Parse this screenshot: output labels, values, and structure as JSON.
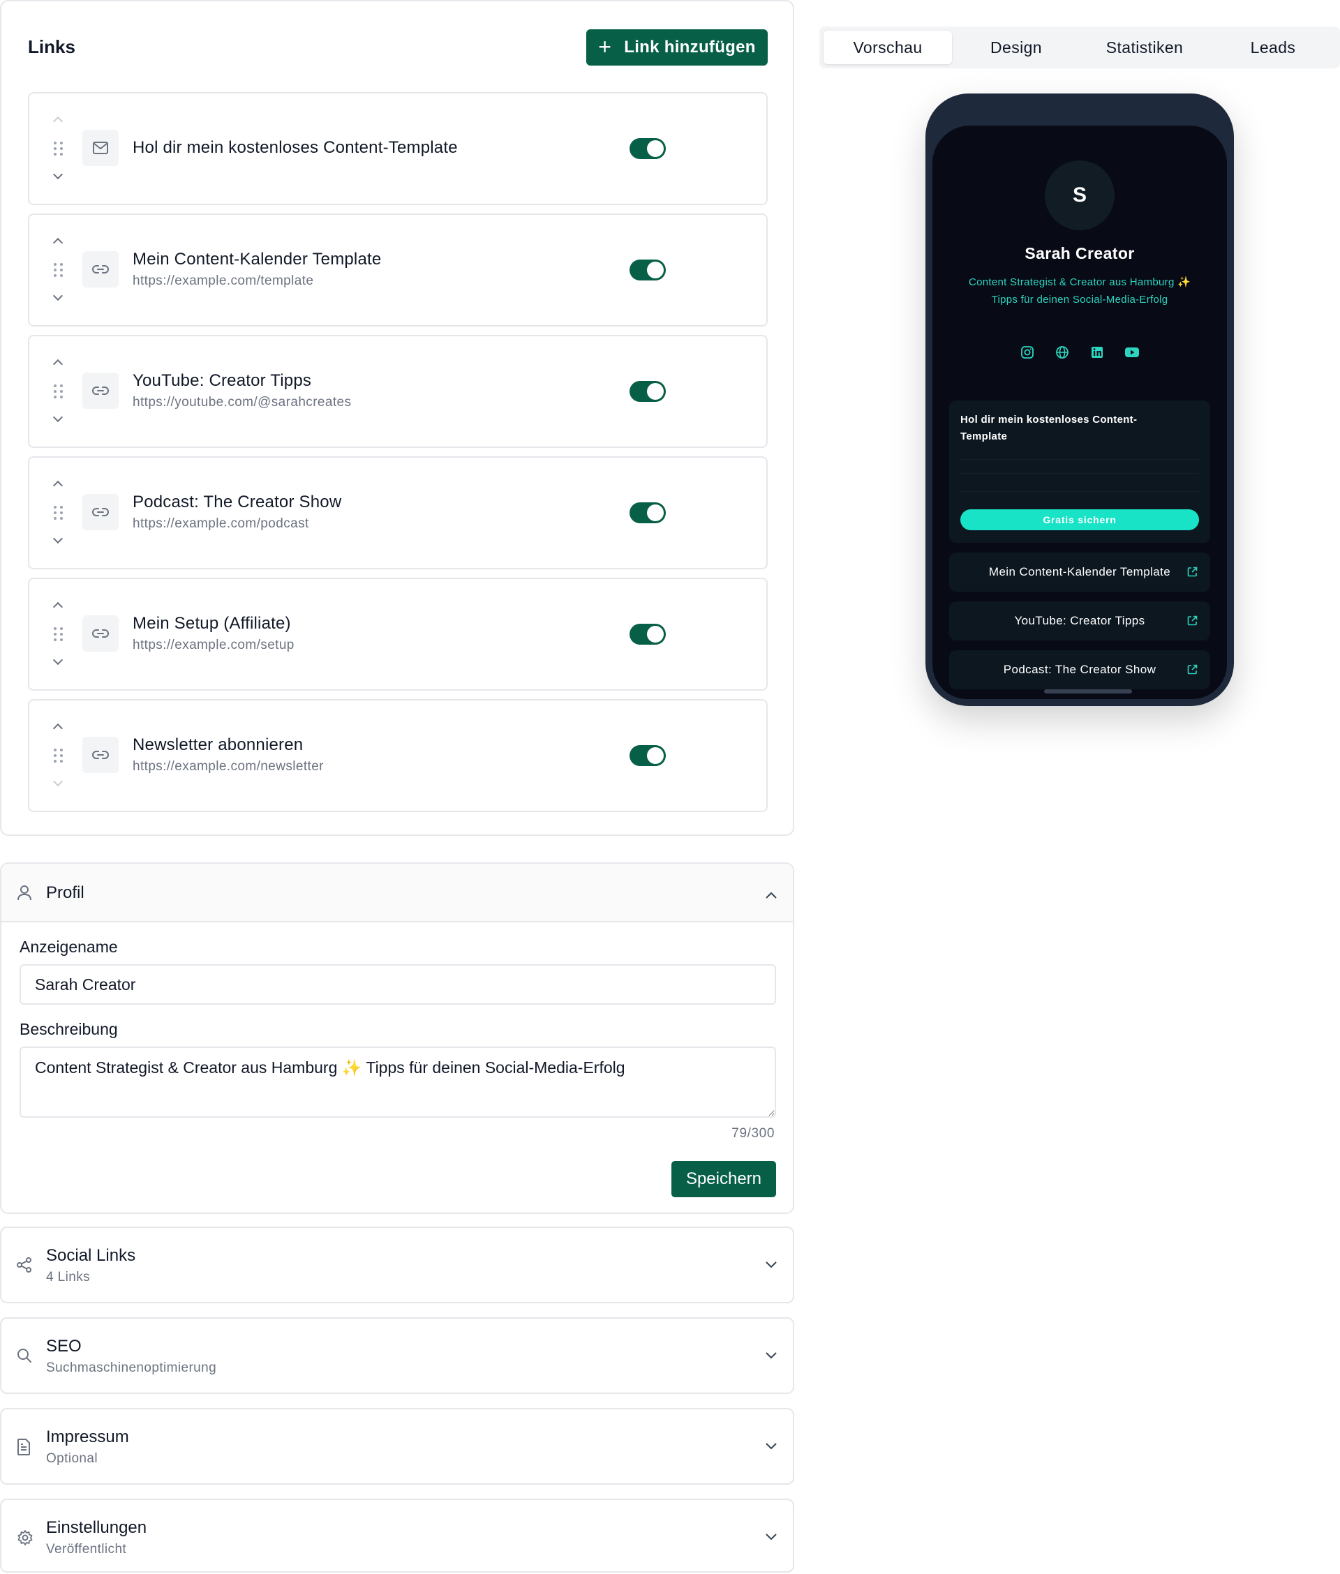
{
  "links_section": {
    "title": "Links",
    "add_button_label": "Link hinzufügen",
    "items": [
      {
        "title": "Hol dir mein kostenloses Content-Template",
        "url": "",
        "icon": "mail-icon",
        "enabled": true
      },
      {
        "title": "Mein Content-Kalender Template",
        "url": "https://example.com/template",
        "icon": "link-icon",
        "enabled": true
      },
      {
        "title": "YouTube: Creator Tipps",
        "url": "https://youtube.com/@sarahcreates",
        "icon": "link-icon",
        "enabled": true
      },
      {
        "title": "Podcast: The Creator Show",
        "url": "https://example.com/podcast",
        "icon": "link-icon",
        "enabled": true
      },
      {
        "title": "Mein Setup (Affiliate)",
        "url": "https://example.com/setup",
        "icon": "link-icon",
        "enabled": true
      },
      {
        "title": "Newsletter abonnieren",
        "url": "https://example.com/newsletter",
        "icon": "link-icon",
        "enabled": true
      }
    ]
  },
  "profil": {
    "title": "Profil",
    "display_name_label": "Anzeigename",
    "display_name_value": "Sarah Creator",
    "description_label": "Beschreibung",
    "description_value": "Content Strategist & Creator aus Hamburg ✨ Tipps für deinen Social-Media-Erfolg",
    "char_count": "79/300",
    "save_label": "Speichern"
  },
  "sections": [
    {
      "title": "Social Links",
      "subtitle": "4 Links",
      "icon": "share-icon"
    },
    {
      "title": "SEO",
      "subtitle": "Suchmaschinenoptimierung",
      "icon": "search-icon"
    },
    {
      "title": "Impressum",
      "subtitle": "Optional",
      "icon": "document-icon"
    },
    {
      "title": "Einstellungen",
      "subtitle": "Veröffentlicht",
      "icon": "gear-icon"
    }
  ],
  "tabs": [
    {
      "label": "Vorschau",
      "active": true
    },
    {
      "label": "Design",
      "active": false
    },
    {
      "label": "Statistiken",
      "active": false
    },
    {
      "label": "Leads",
      "active": false
    }
  ],
  "preview": {
    "avatar_initial": "S",
    "name": "Sarah Creator",
    "bio_line1": "Content Strategist & Creator aus Hamburg ✨",
    "bio_line2": "Tipps für deinen Social-Media-Erfolg",
    "socials": [
      "instagram-icon",
      "globe-icon",
      "linkedin-icon",
      "youtube-icon"
    ],
    "lead_title": "Hol dir mein kostenloses Content-Template",
    "lead_button": "Gratis sichern",
    "links": [
      "Mein Content-Kalender Template",
      "YouTube: Creator Tipps",
      "Podcast: The Creator Show"
    ]
  },
  "colors": {
    "primary": "#065f46",
    "accent": "#2dd4bf",
    "button_accent": "#19e3c6",
    "phone_frame": "#1e293b",
    "phone_screen": "#080b16",
    "border": "#e5e7eb"
  }
}
